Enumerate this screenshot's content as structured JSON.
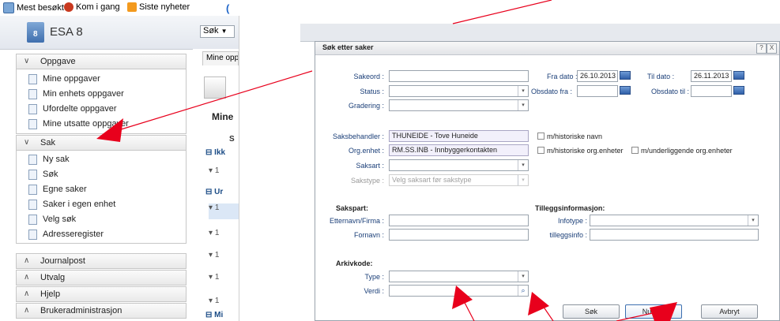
{
  "browser": {
    "bookmarks": [
      {
        "label": "Mest besøkt",
        "icon": "bookmark-page-icon"
      },
      {
        "label": "Kom i gang",
        "icon": "firefox-icon"
      },
      {
        "label": "Siste nyheter",
        "icon": "rss-icon"
      }
    ]
  },
  "app": {
    "title": "ESA 8",
    "logo_number": "8",
    "search_select": "Søk",
    "middle_tab": "Mine opp",
    "middle_heading": "Mine",
    "middle_col": "S",
    "middle_groups": [
      "Ikk",
      "Ur",
      "Mi"
    ],
    "middle_rows": [
      "1",
      "1",
      "1",
      "1",
      "1",
      "1"
    ]
  },
  "nav": {
    "sections": [
      {
        "label": "Oppgave",
        "expanded": true,
        "items": [
          "Mine oppgaver",
          "Min enhets oppgaver",
          "Ufordelte oppgaver",
          "Mine utsatte oppgaver"
        ]
      },
      {
        "label": "Sak",
        "expanded": true,
        "items": [
          "Ny sak",
          "Søk",
          "Egne saker",
          "Saker i egen enhet",
          "Velg søk",
          "Adresseregister"
        ]
      },
      {
        "label": "Journalpost",
        "expanded": false,
        "items": []
      },
      {
        "label": "Utvalg",
        "expanded": false,
        "items": []
      },
      {
        "label": "Hjelp",
        "expanded": false,
        "items": []
      },
      {
        "label": "Brukeradministrasjon",
        "expanded": false,
        "items": []
      }
    ]
  },
  "dialog": {
    "title": "Søk etter saker",
    "help_btn": "?",
    "close_btn": "X",
    "fields": {
      "sakeord": {
        "label": "Sakeord :",
        "value": ""
      },
      "fra_dato": {
        "label": "Fra dato :",
        "value": "26.10.2013"
      },
      "til_dato": {
        "label": "Til dato :",
        "value": "26.11.2013"
      },
      "status": {
        "label": "Status :",
        "value": ""
      },
      "obsdato_fra": {
        "label": "Obsdato fra :",
        "value": ""
      },
      "obsdato_til": {
        "label": "Obsdato til :",
        "value": ""
      },
      "gradering": {
        "label": "Gradering :",
        "value": ""
      },
      "saksbehandler": {
        "label": "Saksbehandler :",
        "value": "THUNEIDE - Tove Huneide"
      },
      "orgenhet": {
        "label": "Org.enhet :",
        "value": "RM.SS.INB - Innbyggerkontakten"
      },
      "saksart": {
        "label": "Saksart :",
        "value": ""
      },
      "sakstype": {
        "label": "Sakstype :",
        "placeholder": "Velg saksart før sakstype"
      },
      "etternavn": {
        "label": "Etternavn/Firma :",
        "value": ""
      },
      "fornavn": {
        "label": "Fornavn :",
        "value": ""
      },
      "infotype": {
        "label": "Infotype :",
        "value": ""
      },
      "tilleggsinfo": {
        "label": "tilleggsinfo :",
        "value": ""
      },
      "type": {
        "label": "Type :",
        "value": ""
      },
      "verdi": {
        "label": "Verdi :",
        "value": ""
      }
    },
    "checkboxes": {
      "historiske_navn": "m/historiske navn",
      "historiske_org": "m/historiske org.enheter",
      "underliggende_org": "m/underliggende org.enheter"
    },
    "sections": {
      "sakspart": "Sakspart:",
      "tilleggsinformasjon": "Tilleggsinformasjon:",
      "arkivkode": "Arkivkode:"
    },
    "buttons": {
      "sok": "Søk",
      "nullstill": "Nullstill",
      "avbryt": "Avbryt"
    }
  },
  "colors": {
    "annotation_arrow": "#e8001c",
    "label_blue": "#1b3f78"
  }
}
